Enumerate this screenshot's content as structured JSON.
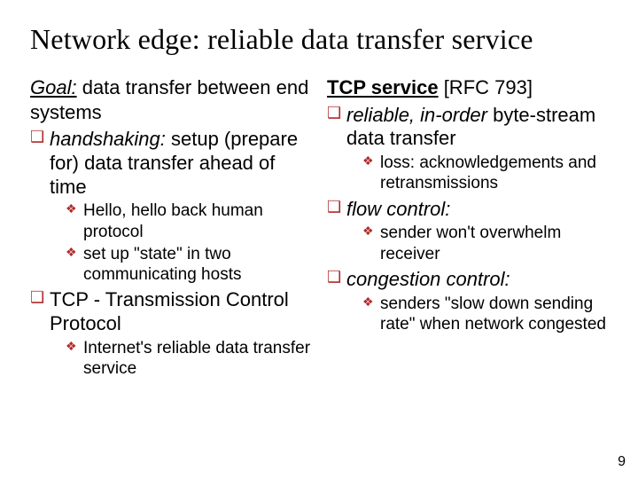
{
  "title": "Network edge: reliable data transfer service",
  "left": {
    "lead_u": "Goal:",
    "lead_rest": " data transfer between end systems",
    "q1_prefix": "handshaking:",
    "q1_rest": " setup (prepare for) data transfer ahead of time",
    "q1_d1": "Hello, hello back human protocol",
    "q1_d2": "set up \"state\" in two communicating hosts",
    "q2": "TCP - Transmission Control Protocol",
    "q2_d1": "Internet's reliable data transfer service"
  },
  "right": {
    "lead_u": "TCP service",
    "lead_rest": " [RFC 793]",
    "q1_prefix": "reliable, in-order",
    "q1_rest": " byte-stream data transfer",
    "q1_d1": "loss: acknowledgements and retransmissions",
    "q2": "flow control:",
    "q2_d1": "sender won't overwhelm receiver",
    "q3": "congestion control:",
    "q3_d1": "senders \"slow down sending rate\" when network congested"
  },
  "page_number": "9"
}
